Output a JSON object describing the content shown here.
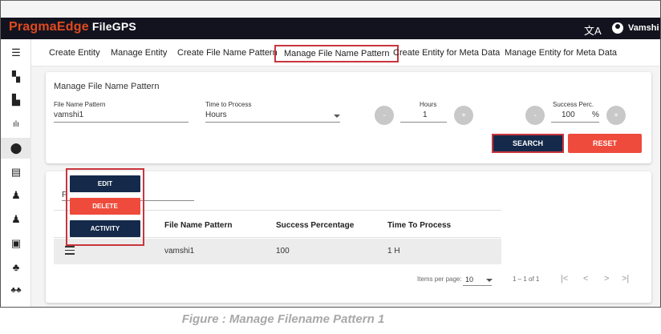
{
  "app": {
    "brand": "PragmaEdge",
    "product": "FileGPS",
    "translate_icon": "translate-icon",
    "user_name": "Vamshi"
  },
  "sidebar": {
    "items": [
      {
        "name": "menu-icon",
        "glyph": "☰"
      },
      {
        "name": "dashboard-icon",
        "glyph": "▚"
      },
      {
        "name": "files-icon",
        "glyph": "▙"
      },
      {
        "name": "chart-icon",
        "glyph": "ılı"
      },
      {
        "name": "account-icon",
        "glyph": "●"
      },
      {
        "name": "document-icon",
        "glyph": "▤"
      },
      {
        "name": "alert-icon",
        "glyph": "♟"
      },
      {
        "name": "alert-settings-icon",
        "glyph": "♟"
      },
      {
        "name": "entity-icon",
        "glyph": "▣"
      },
      {
        "name": "user-settings-icon",
        "glyph": "♣"
      },
      {
        "name": "users-icon",
        "glyph": "♣♣"
      }
    ]
  },
  "tabs": [
    {
      "label": "Create Entity"
    },
    {
      "label": "Manage Entity"
    },
    {
      "label": "Create File Name Pattern"
    },
    {
      "label": "Manage File Name Pattern"
    },
    {
      "label": "Create Entity for Meta Data"
    },
    {
      "label": "Manage Entity for Meta Data"
    }
  ],
  "search_form": {
    "title": "Manage File Name Pattern",
    "file_name_pattern_label": "File Name Pattern",
    "file_name_pattern_value": "vamshi1",
    "time_to_process_label": "Time to Process",
    "time_to_process_value": "Hours",
    "hours_label": "Hours",
    "hours_value": "1",
    "success_label": "Success Perc.",
    "success_value": "100",
    "success_unit": "%",
    "minus": "-",
    "plus": "+",
    "search_label": "SEARCH",
    "reset_label": "RESET"
  },
  "results": {
    "filter_char": "F",
    "columns": [
      "File Name Pattern",
      "Success Percentage",
      "Time To Process"
    ],
    "rows": [
      {
        "file_name_pattern": "vamshi1",
        "success_percentage": "100",
        "time_to_process": "1 H"
      }
    ],
    "items_per_page_label": "Items per page:",
    "items_per_page_value": "10",
    "range_label": "1 – 1 of 1",
    "nav": {
      "first": "|<",
      "prev": "<",
      "next": ">",
      "last": ">|"
    }
  },
  "row_menu": {
    "edit_label": "EDIT",
    "delete_label": "DELETE",
    "activity_label": "ACTIVITY"
  },
  "caption": "Figure : Manage Filename Pattern 1",
  "colors": {
    "appbar": "#13131f",
    "brand": "#e04a1f",
    "primary_button": "#152a4a",
    "danger_button": "#ef4b3c",
    "highlight": "#c9353d"
  }
}
